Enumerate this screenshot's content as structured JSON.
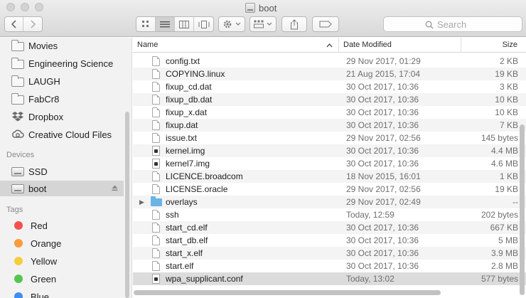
{
  "window": {
    "title": "boot"
  },
  "toolbar": {
    "search_placeholder": "Search"
  },
  "sidebar": {
    "favorites": [
      {
        "label": "Movies",
        "icon": "folder-icon"
      },
      {
        "label": "Engineering Science",
        "icon": "folder-icon"
      },
      {
        "label": "LAUGH",
        "icon": "folder-icon"
      },
      {
        "label": "FabCr8",
        "icon": "folder-icon"
      },
      {
        "label": "Dropbox",
        "icon": "dropbox-icon"
      },
      {
        "label": "Creative Cloud Files",
        "icon": "creative-cloud-icon"
      }
    ],
    "devices_header": "Devices",
    "devices": [
      {
        "label": "SSD",
        "icon": "drive-icon"
      },
      {
        "label": "boot",
        "icon": "drive-icon",
        "selected": true
      }
    ],
    "tags_header": "Tags",
    "tags": [
      {
        "label": "Red",
        "color": "#f5504e"
      },
      {
        "label": "Orange",
        "color": "#f79b3c"
      },
      {
        "label": "Yellow",
        "color": "#f5cd3b"
      },
      {
        "label": "Green",
        "color": "#55c552"
      },
      {
        "label": "Blue",
        "color": "#3e8df2"
      }
    ]
  },
  "columns": {
    "name": "Name",
    "date": "Date Modified",
    "size": "Size"
  },
  "files": [
    {
      "name": "config.txt",
      "date": "29 Nov 2017, 01:29",
      "size": "2 KB",
      "kind": "file"
    },
    {
      "name": "COPYING.linux",
      "date": "21 Aug 2015, 17:04",
      "size": "19 KB",
      "kind": "file"
    },
    {
      "name": "fixup_cd.dat",
      "date": "30 Oct 2017, 10:36",
      "size": "3 KB",
      "kind": "file"
    },
    {
      "name": "fixup_db.dat",
      "date": "30 Oct 2017, 10:36",
      "size": "10 KB",
      "kind": "file"
    },
    {
      "name": "fixup_x.dat",
      "date": "30 Oct 2017, 10:36",
      "size": "10 KB",
      "kind": "file"
    },
    {
      "name": "fixup.dat",
      "date": "30 Oct 2017, 10:36",
      "size": "7 KB",
      "kind": "file"
    },
    {
      "name": "issue.txt",
      "date": "29 Nov 2017, 02:56",
      "size": "145 bytes",
      "kind": "file"
    },
    {
      "name": "kernel.img",
      "date": "30 Oct 2017, 10:36",
      "size": "4.4 MB",
      "kind": "exec"
    },
    {
      "name": "kernel7.img",
      "date": "30 Oct 2017, 10:36",
      "size": "4.6 MB",
      "kind": "exec"
    },
    {
      "name": "LICENCE.broadcom",
      "date": "18 Nov 2015, 16:01",
      "size": "1 KB",
      "kind": "file"
    },
    {
      "name": "LICENSE.oracle",
      "date": "29 Nov 2017, 02:56",
      "size": "19 KB",
      "kind": "file"
    },
    {
      "name": "overlays",
      "date": "29 Nov 2017, 02:49",
      "size": "--",
      "kind": "folder"
    },
    {
      "name": "ssh",
      "date": "Today, 12:59",
      "size": "202 bytes",
      "kind": "file"
    },
    {
      "name": "start_cd.elf",
      "date": "30 Oct 2017, 10:36",
      "size": "667 KB",
      "kind": "file"
    },
    {
      "name": "start_db.elf",
      "date": "30 Oct 2017, 10:36",
      "size": "5 MB",
      "kind": "file"
    },
    {
      "name": "start_x.elf",
      "date": "30 Oct 2017, 10:36",
      "size": "3.9 MB",
      "kind": "file"
    },
    {
      "name": "start.elf",
      "date": "30 Oct 2017, 10:36",
      "size": "2.8 MB",
      "kind": "file"
    },
    {
      "name": "wpa_supplicant.conf",
      "date": "Today, 13:02",
      "size": "577 bytes",
      "kind": "exec",
      "selected": true
    }
  ]
}
